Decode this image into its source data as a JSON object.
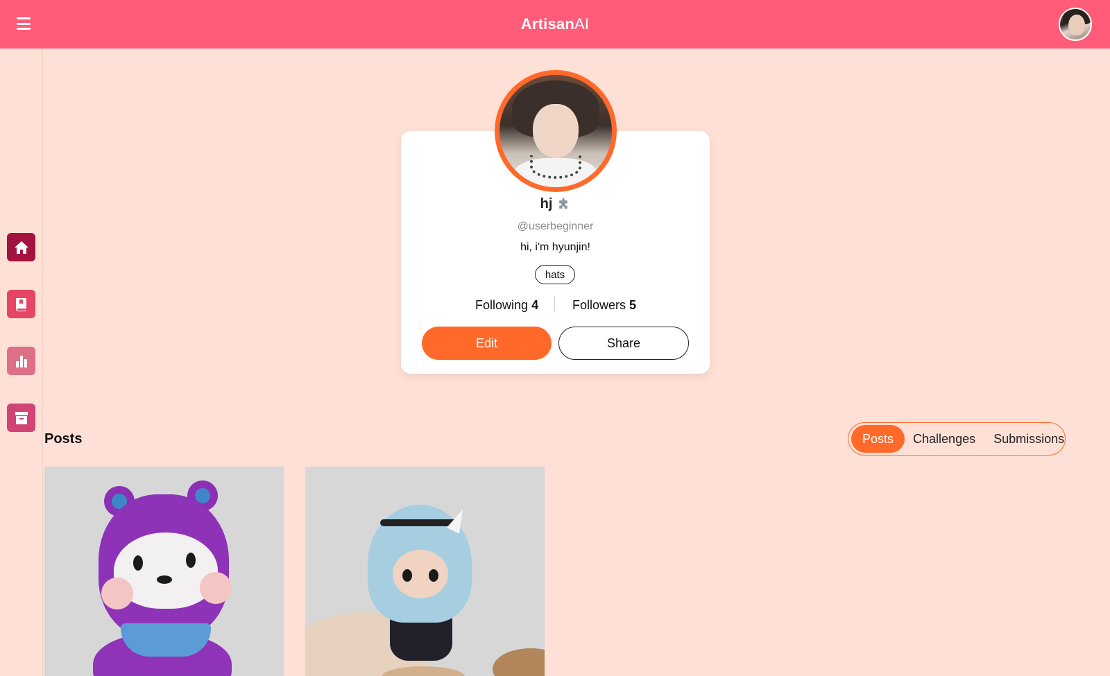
{
  "app": {
    "brand_bold": "Artisan",
    "brand_light": "AI"
  },
  "colors": {
    "topbar": "#ff5c7a",
    "background": "#ffe0d6",
    "accent": "#ff6a2a",
    "sidebar_home": "#a3133f",
    "sidebar_other": [
      "#e64565",
      "#dd6f86",
      "#d04573"
    ]
  },
  "header": {
    "menu_icon": "menu-icon",
    "avatar_icon": "user-avatar"
  },
  "sidebar": {
    "items": [
      {
        "icon": "home-icon"
      },
      {
        "icon": "book-icon"
      },
      {
        "icon": "bar-chart-icon"
      },
      {
        "icon": "archive-icon"
      }
    ]
  },
  "profile": {
    "name": "hj",
    "badge_icon": "puzzle-icon",
    "handle": "@userbeginner",
    "bio": "hi, i'm hyunjin!",
    "tags": [
      "hats"
    ],
    "following_label": "Following",
    "following_count": "4",
    "followers_label": "Followers",
    "followers_count": "5",
    "edit_label": "Edit",
    "share_label": "Share"
  },
  "posts_section": {
    "title": "Posts",
    "tabs": [
      {
        "label": "Posts",
        "active": true
      },
      {
        "label": "Challenges",
        "active": false
      },
      {
        "label": "Submissions",
        "active": false
      }
    ]
  }
}
